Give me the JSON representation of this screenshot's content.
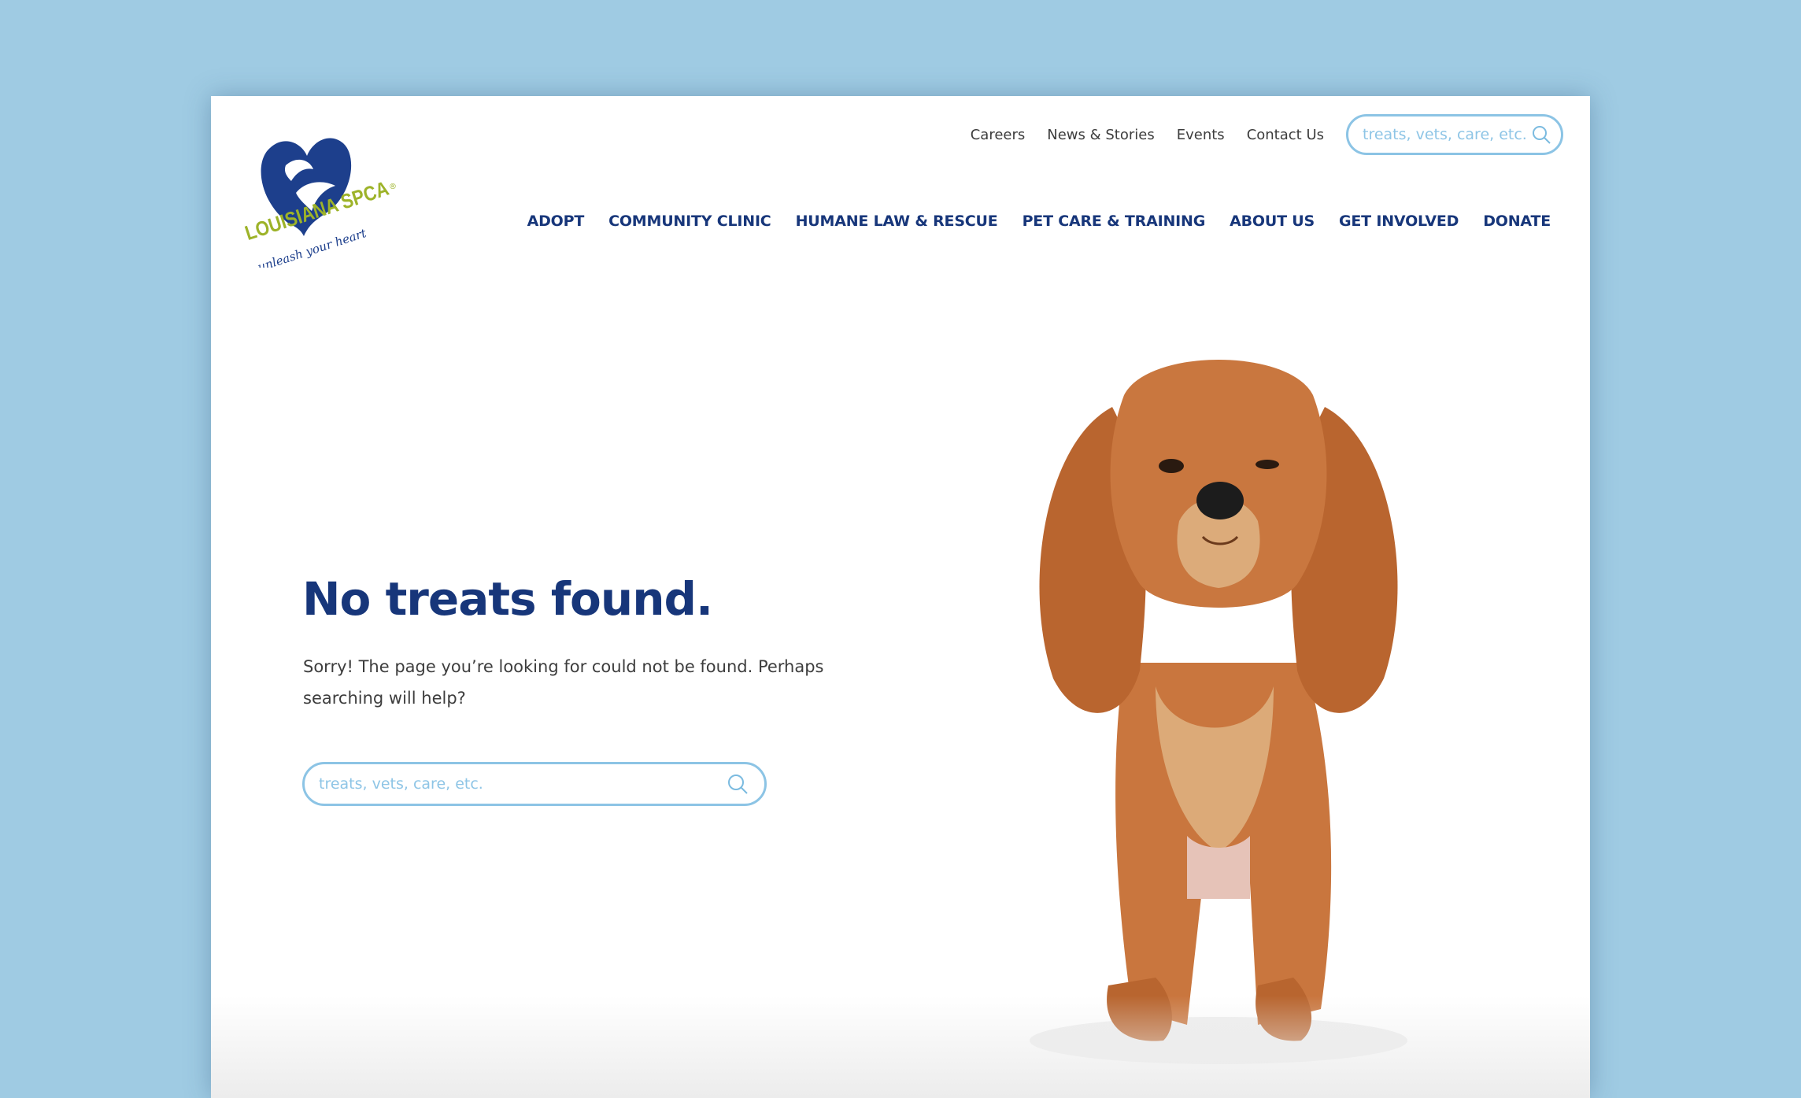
{
  "logo": {
    "wordmark": "LOUISIANA SPCA",
    "tagline": "unleash your heart",
    "registered": "®"
  },
  "top_nav": {
    "items": [
      "Careers",
      "News & Stories",
      "Events",
      "Contact Us"
    ],
    "search_placeholder": "treats, vets, care, etc."
  },
  "main_nav": {
    "items": [
      "ADOPT",
      "COMMUNITY CLINIC",
      "HUMANE LAW & RESCUE",
      "PET CARE & TRAINING",
      "ABOUT US",
      "GET INVOLVED",
      "DONATE"
    ]
  },
  "content": {
    "heading": "No treats found.",
    "body": "Sorry! The page you’re looking for could not be found. Perhaps searching will help?",
    "search_placeholder": "treats, vets, care, etc."
  },
  "colors": {
    "background": "#9fcbe3",
    "brand_navy": "#17367a",
    "brand_green": "#9db329",
    "search_border": "#8cc4e5"
  }
}
